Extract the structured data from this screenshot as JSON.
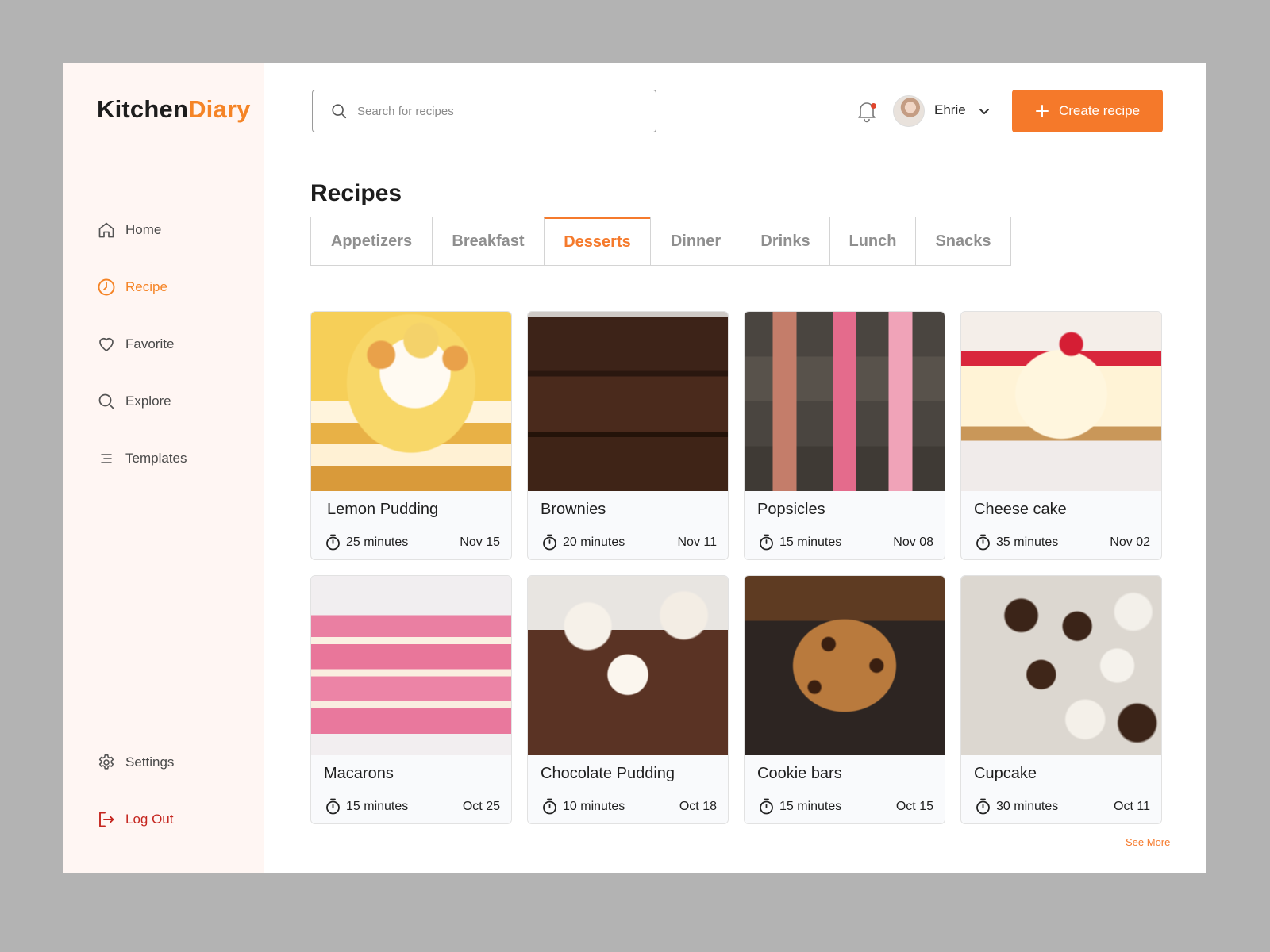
{
  "app": {
    "logo_part1": "Kitchen",
    "logo_part2": "Diary",
    "accent_color": "#f58426"
  },
  "sidebar": {
    "items": [
      {
        "label": "Home",
        "icon": "home-icon"
      },
      {
        "label": "Recipe",
        "icon": "clock-icon",
        "active": true
      },
      {
        "label": "Favorite",
        "icon": "heart-icon"
      },
      {
        "label": "Explore",
        "icon": "search-icon"
      },
      {
        "label": "Templates",
        "icon": "list-icon"
      }
    ],
    "settings_label": "Settings",
    "logout_label": "Log Out"
  },
  "header": {
    "search_placeholder": "Search for recipes",
    "user_name": "Ehrie",
    "create_button": "Create recipe"
  },
  "main": {
    "title": "Recipes",
    "tabs": [
      {
        "label": "Appetizers"
      },
      {
        "label": "Breakfast"
      },
      {
        "label": "Desserts",
        "active": true
      },
      {
        "label": "Dinner"
      },
      {
        "label": "Drinks"
      },
      {
        "label": "Lunch"
      },
      {
        "label": "Snacks"
      }
    ],
    "recipes": [
      {
        "name": "Lemon Pudding",
        "time": "25 minutes",
        "date": "Nov 15"
      },
      {
        "name": "Brownies",
        "time": "20 minutes",
        "date": "Nov 11"
      },
      {
        "name": "Popsicles",
        "time": "15 minutes",
        "date": "Nov 08"
      },
      {
        "name": "Cheese cake",
        "time": "35 minutes",
        "date": "Nov 02"
      },
      {
        "name": "Macarons",
        "time": "15 minutes",
        "date": "Oct 25"
      },
      {
        "name": "Chocolate Pudding",
        "time": "10 minutes",
        "date": "Oct 18"
      },
      {
        "name": "Cookie bars",
        "time": "15 minutes",
        "date": "Oct 15"
      },
      {
        "name": "Cupcake",
        "time": "30 minutes",
        "date": "Oct 11"
      }
    ],
    "see_more": "See More"
  }
}
